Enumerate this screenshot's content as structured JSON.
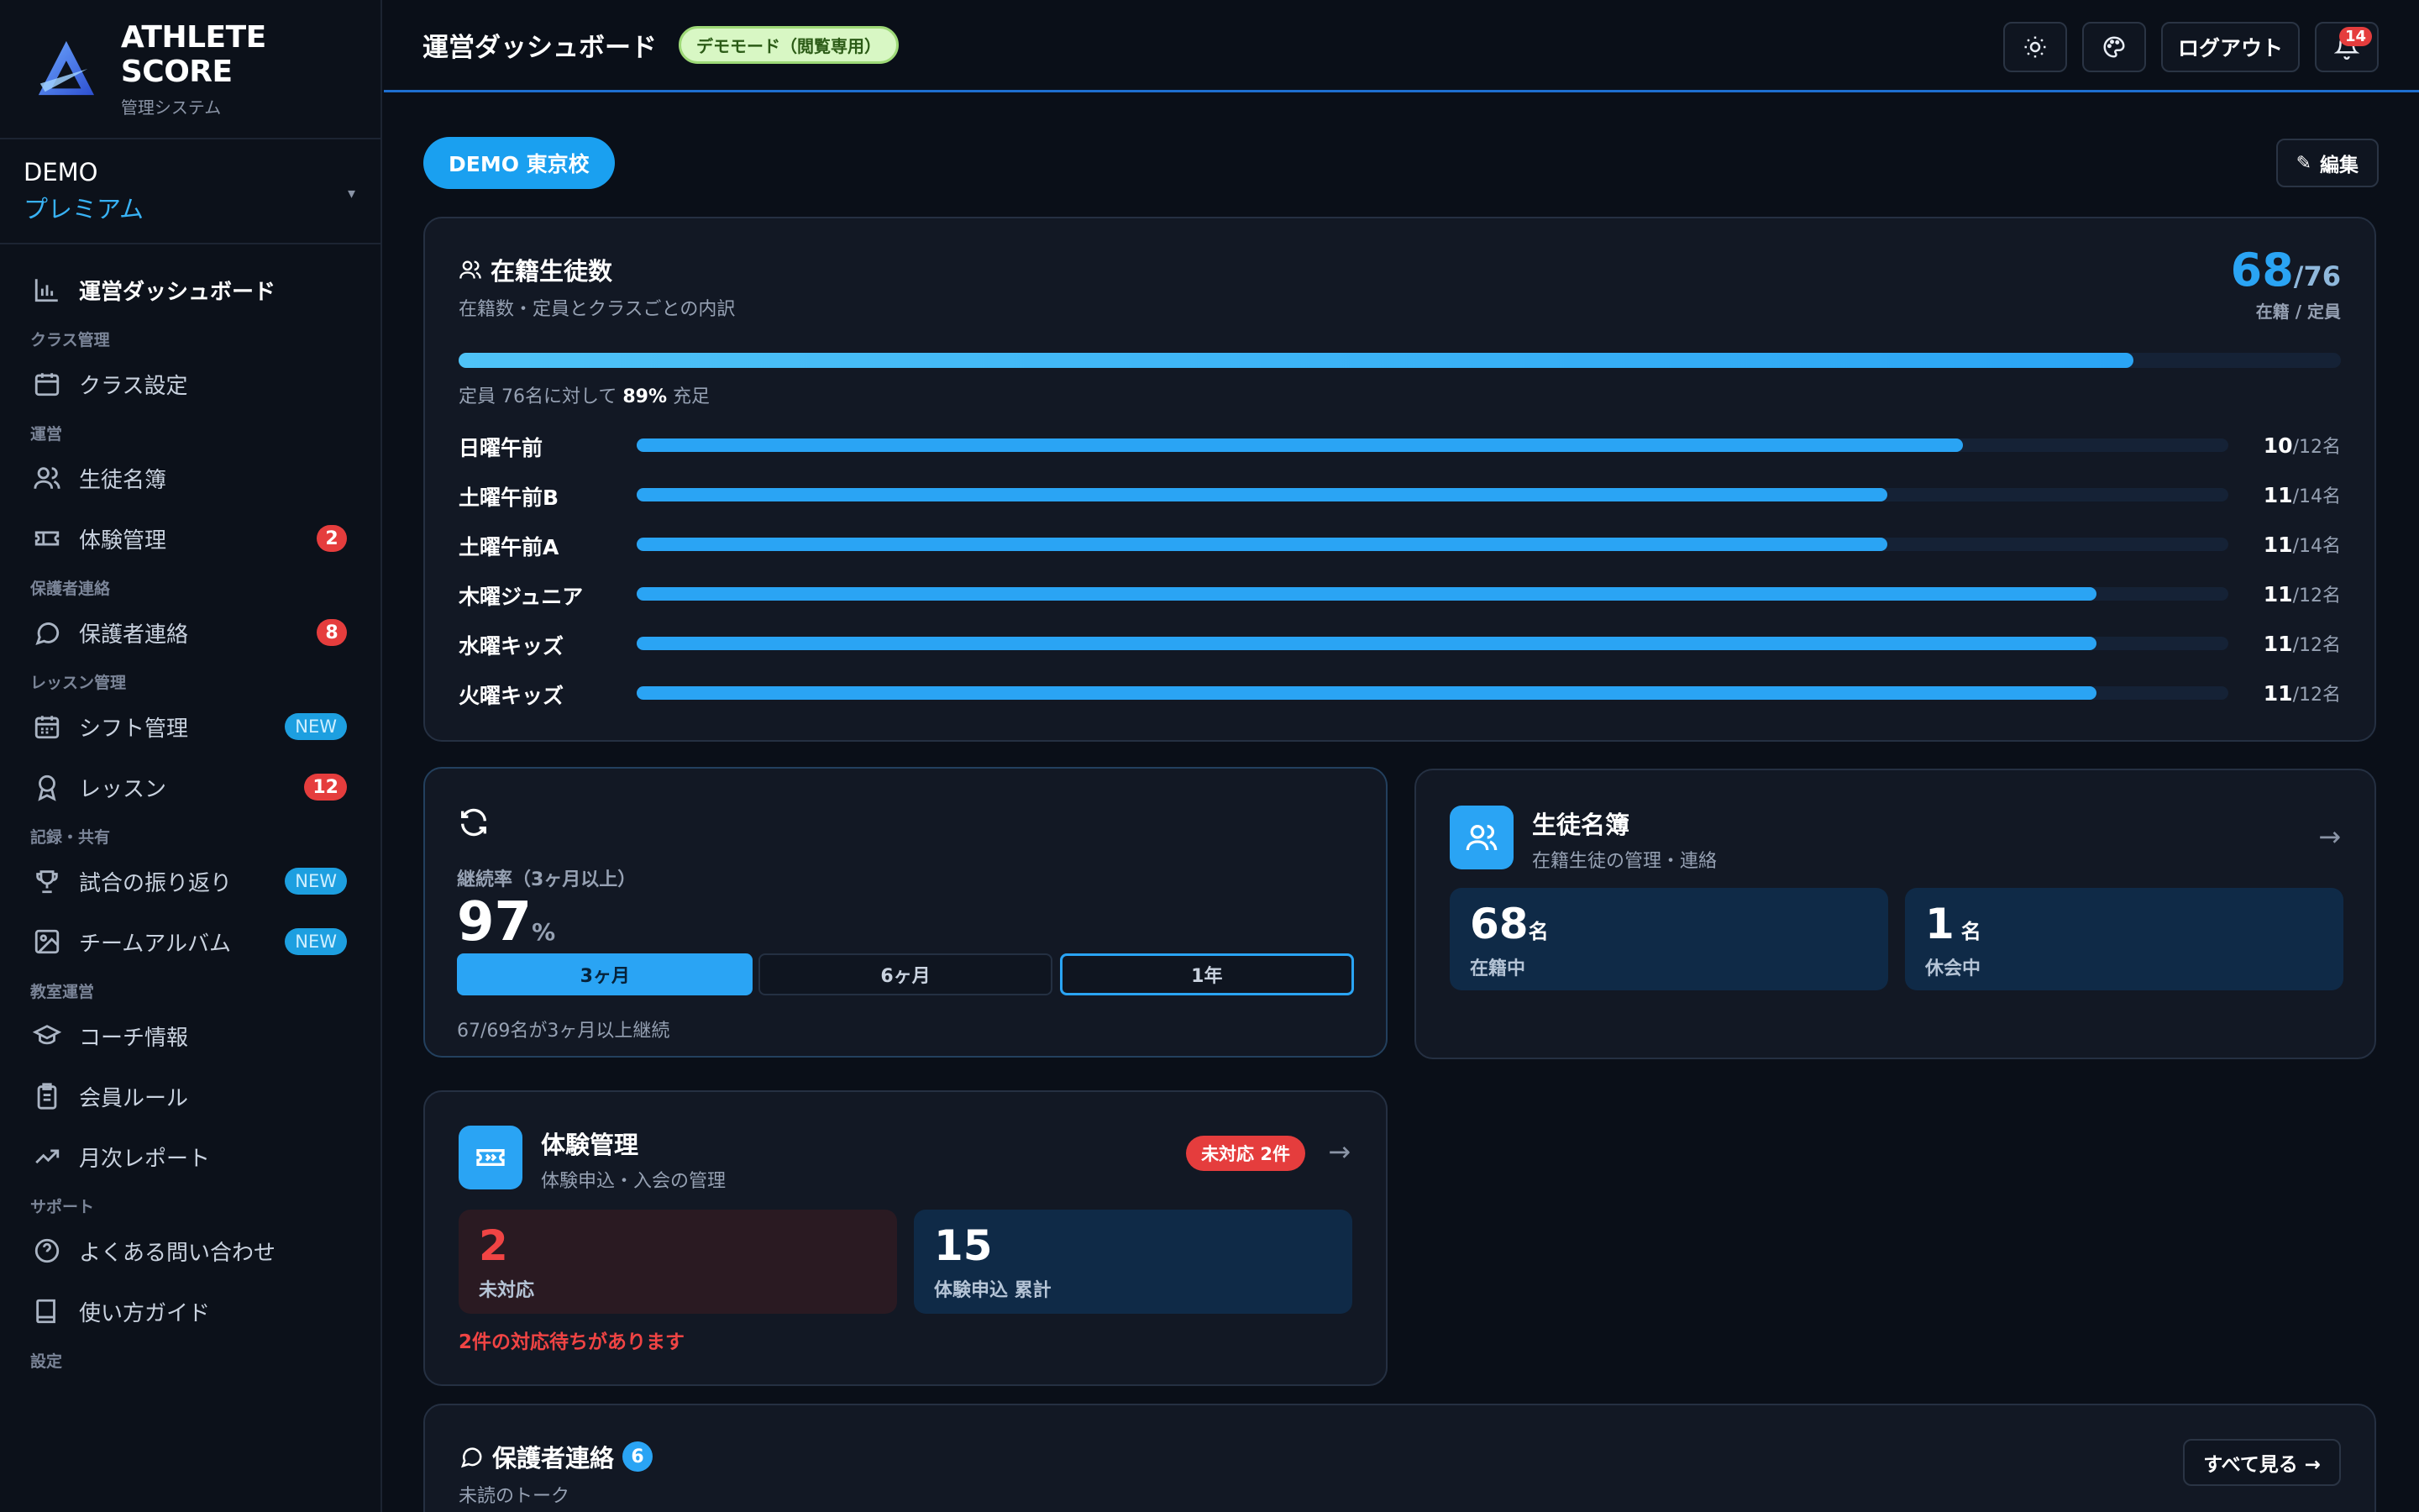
{
  "brand": {
    "title": "ATHLETE SCORE",
    "subtitle": "管理システム"
  },
  "tenant": {
    "name": "DEMO",
    "plan": "プレミアム"
  },
  "nav": {
    "dashboard": "運営ダッシュボード",
    "sec_class": "クラス管理",
    "class_settings": "クラス設定",
    "sec_ops": "運営",
    "students": "生徒名簿",
    "trial": "体験管理",
    "trial_badge": "2",
    "sec_guardian": "保護者連絡",
    "guardian": "保護者連絡",
    "guardian_badge": "8",
    "sec_lesson": "レッスン管理",
    "shift": "シフト管理",
    "shift_badge": "NEW",
    "lesson": "レッスン",
    "lesson_badge": "12",
    "sec_record": "記録・共有",
    "review": "試合の振り返り",
    "review_badge": "NEW",
    "album": "チームアルバム",
    "album_badge": "NEW",
    "sec_school": "教室運営",
    "coach": "コーチ情報",
    "rules": "会員ルール",
    "report": "月次レポート",
    "sec_support": "サポート",
    "faq": "よくある問い合わせ",
    "guide": "使い方ガイド",
    "sec_settings": "設定"
  },
  "header": {
    "title": "運営ダッシュボード",
    "demo_chip": "デモモード（閲覧専用）",
    "logout": "ログアウト",
    "notif_count": "14"
  },
  "school_chip": "DEMO 東京校",
  "edit_label": "編集",
  "enrollment": {
    "title": "在籍生徒数",
    "subtitle": "在籍数・定員とクラスごとの内訳",
    "current": "68",
    "capacity": "/76",
    "caption": "在籍 / 定員",
    "fill_ratio": 0.89,
    "note_prefix": "定員 76名に対して",
    "note_pct": "89%",
    "note_suffix": "充足",
    "classes": [
      {
        "name": "日曜午前",
        "count": "10",
        "cap": "/12名",
        "ratio": 0.833
      },
      {
        "name": "土曜午前B",
        "count": "11",
        "cap": "/14名",
        "ratio": 0.786
      },
      {
        "name": "土曜午前A",
        "count": "11",
        "cap": "/14名",
        "ratio": 0.786
      },
      {
        "name": "木曜ジュニア",
        "count": "11",
        "cap": "/12名",
        "ratio": 0.917
      },
      {
        "name": "水曜キッズ",
        "count": "11",
        "cap": "/12名",
        "ratio": 0.917
      },
      {
        "name": "火曜キッズ",
        "count": "11",
        "cap": "/12名",
        "ratio": 0.917
      }
    ]
  },
  "retention": {
    "label": "継続率（3ヶ月以上）",
    "value": "97",
    "unit": "%",
    "tabs": [
      "3ヶ月",
      "6ヶ月",
      "1年"
    ],
    "note": "67/69名が3ヶ月以上継続"
  },
  "roster": {
    "title": "生徒名簿",
    "subtitle": "在籍生徒の管理・連絡",
    "enrolled": "68",
    "enrolled_unit": "名",
    "enrolled_label": "在籍中",
    "paused": "1",
    "paused_unit": "名",
    "paused_label": "休会中"
  },
  "trial": {
    "title": "体験管理",
    "subtitle": "体験申込・入会の管理",
    "pending_chip": "未対応 2件",
    "pending": "2",
    "pending_label": "未対応",
    "total": "15",
    "total_label": "体験申込 累計",
    "warning": "2件の対応待ちがあります"
  },
  "guardian": {
    "title": "保護者連絡",
    "count": "6",
    "subtitle": "未読のトーク",
    "see_all": "すべて見る →"
  },
  "colors": {
    "accent": "#2aa4f4",
    "danger": "#e53d3d",
    "background": "#0a0f18"
  }
}
